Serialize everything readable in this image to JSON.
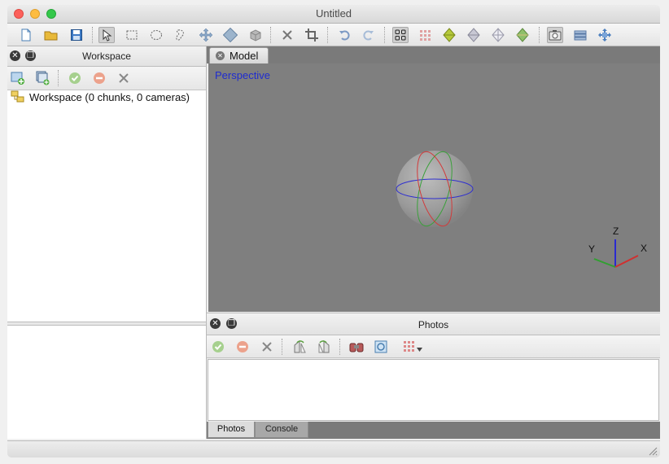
{
  "window": {
    "title": "Untitled"
  },
  "workspace": {
    "panel_title": "Workspace",
    "tree_root": "Workspace (0 chunks, 0 cameras)"
  },
  "model": {
    "tab_label": "Model",
    "view_label": "Perspective",
    "axes": {
      "x": "X",
      "y": "Y",
      "z": "Z"
    }
  },
  "photos": {
    "panel_title": "Photos",
    "bottom_tabs": [
      "Photos",
      "Console"
    ],
    "active_tab": "Photos"
  },
  "toolbar": {
    "icons": [
      "new-document-icon",
      "open-folder-icon",
      "save-icon",
      "navigation-arrow-icon",
      "rectangle-selection-icon",
      "circle-selection-icon",
      "free-form-selection-icon",
      "move-object-icon",
      "rotate-object-icon",
      "scale-object-icon",
      "delete-selection-icon",
      "crop-selection-icon",
      "undo-icon",
      "redo-icon",
      "show-cameras-icon",
      "dense-cloud-icon",
      "shaded-model-icon",
      "solid-model-icon",
      "wireframe-model-icon",
      "textured-model-icon",
      "capture-view-icon",
      "region-icon",
      "reset-view-icon"
    ]
  },
  "colors": {
    "viewport_bg": "#7f7f7f",
    "perspective_label": "#1f2ccf",
    "axis_x": "#d03030",
    "axis_y": "#30a030",
    "axis_z": "#2a2ad0"
  }
}
